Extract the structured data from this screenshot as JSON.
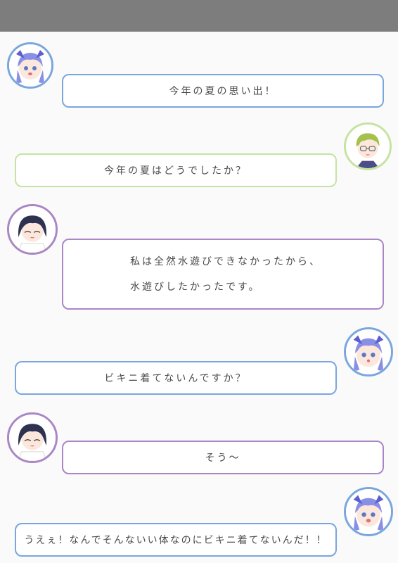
{
  "colors": {
    "topbar": "#7d7d7d",
    "background": "#fafafa",
    "blue_border": "#7aa6de",
    "green_border": "#c6e3a2",
    "purple_border": "#aa86c6"
  },
  "messages": [
    {
      "speaker_avatar": "blue-haired-girl-avatar",
      "side": "left",
      "lines": [
        "今年の夏の思い出！"
      ]
    },
    {
      "speaker_avatar": "green-haired-boy-avatar",
      "side": "right",
      "lines": [
        "今年の夏はどうでしたか？"
      ]
    },
    {
      "speaker_avatar": "dark-haired-girl-avatar",
      "side": "left",
      "lines": [
        "私は全然水遊びできなかったから、",
        "水遊びしたかったです。"
      ]
    },
    {
      "speaker_avatar": "blue-haired-girl-avatar",
      "side": "right",
      "lines": [
        "ビキニ着てないんですか？"
      ]
    },
    {
      "speaker_avatar": "dark-haired-girl-avatar",
      "side": "left",
      "lines": [
        "そう～"
      ]
    },
    {
      "speaker_avatar": "blue-haired-girl-avatar",
      "side": "right",
      "lines": [
        "うえぇ！なんでそんないい体なのにビキニ着てないんだ！！"
      ]
    }
  ]
}
